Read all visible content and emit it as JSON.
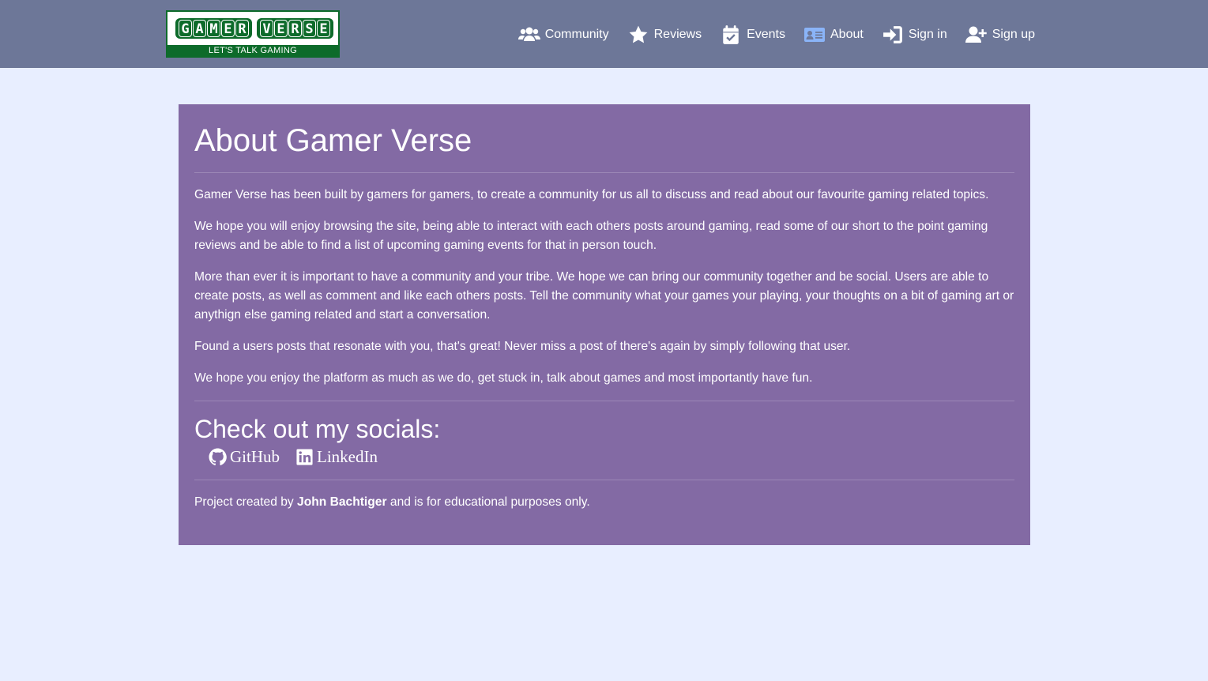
{
  "navbar": {
    "logo": {
      "word1": [
        "G",
        "A",
        "M",
        "E",
        "R"
      ],
      "word2": [
        "V",
        "E",
        "R",
        "S",
        "E"
      ],
      "tagline": "LET'S TALK GAMING"
    },
    "links": [
      {
        "label": "Community",
        "icon": "users-icon"
      },
      {
        "label": "Reviews",
        "icon": "star-icon"
      },
      {
        "label": "Events",
        "icon": "calendar-check-icon"
      },
      {
        "label": "About",
        "icon": "id-card-icon"
      },
      {
        "label": "Sign in",
        "icon": "sign-in-icon"
      },
      {
        "label": "Sign up",
        "icon": "user-plus-icon"
      }
    ]
  },
  "about": {
    "title": "About Gamer Verse",
    "paragraphs": [
      "Gamer Verse has been built by gamers for gamers, to create a community for us all to discuss and read about our favourite gaming related topics.",
      "We hope you will enjoy browsing the site, being able to interact with each others posts around gaming, read some of our short to the point gaming reviews and be able to find a list of upcoming gaming events for that in person touch.",
      "More than ever it is important to have a community and your tribe. We hope we can bring our community together and be social. Users are able to create posts, as well as comment and like each others posts. Tell the community what your games your playing, your thoughts on a bit of gaming art or anythign else gaming related and start a conversation.",
      "Found a users posts that resonate with you, that's great! Never miss a post of there's again by simply following that user.",
      "We hope you enjoy the platform as much as we do, get stuck in, talk about games and most importantly have fun."
    ],
    "socials_heading": "Check out my socials:",
    "socials": [
      {
        "label": "GitHub",
        "icon": "github-icon"
      },
      {
        "label": "LinkedIn",
        "icon": "linkedin-icon"
      }
    ],
    "footer": {
      "prefix": "Project created by",
      "author": "John Bachtiger",
      "suffix": "and is for educational purposes only."
    }
  },
  "colors": {
    "navbar_bg": "#6d7798",
    "page_bg": "#e8eeff",
    "card_bg": "#836aa4",
    "logo_green": "#0d6b2a",
    "about_icon": "#8ab4f8"
  }
}
